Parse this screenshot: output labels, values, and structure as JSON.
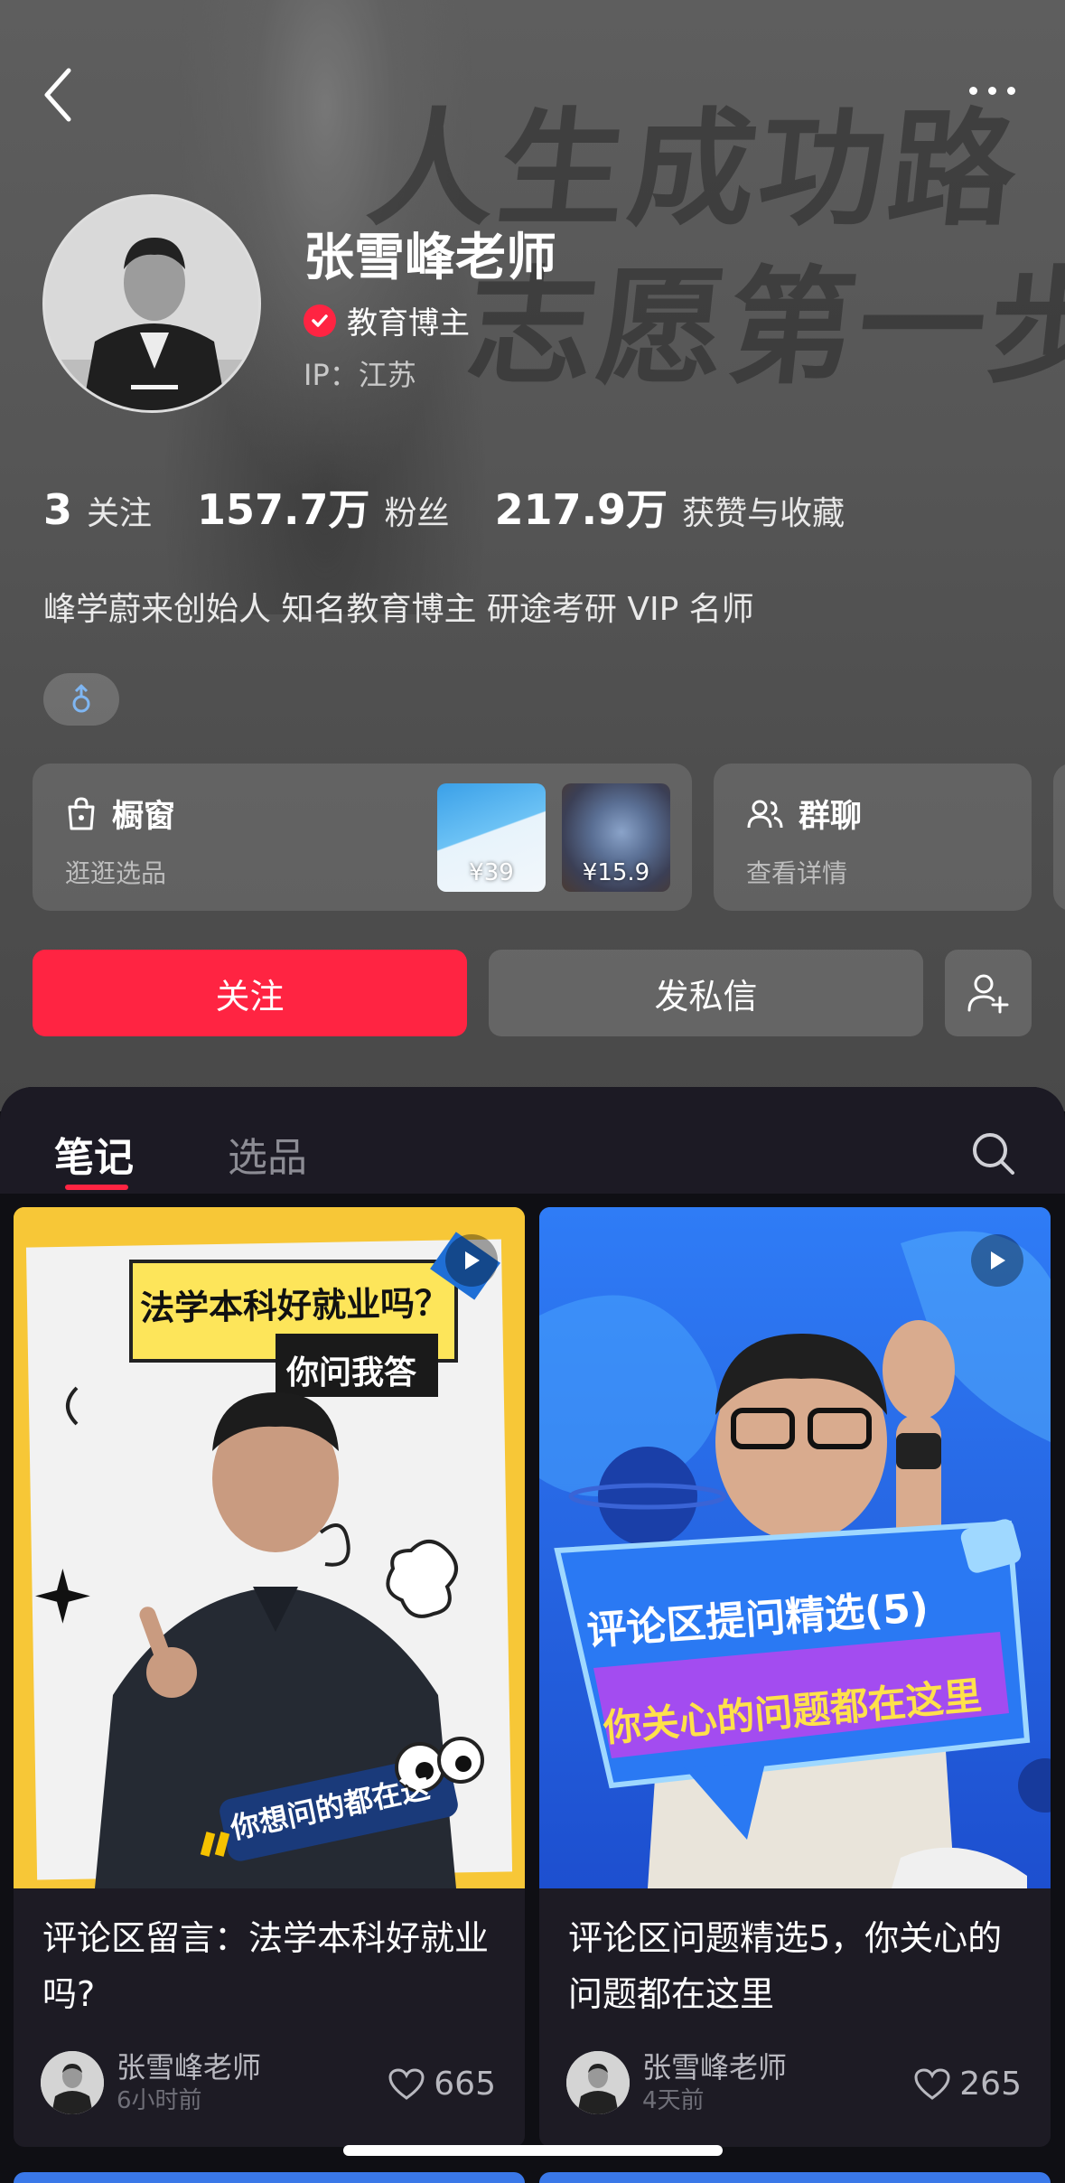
{
  "profile": {
    "name": "张雪峰老师",
    "verify_label": "教育博主",
    "ip_label": "IP：",
    "ip_region": "江苏",
    "background_slogan_line1": "人生成功路",
    "background_slogan_line2": "志愿第一步",
    "bio": "峰学蔚来创始人 知名教育博主 研途考研 VIP 名师",
    "gender_icon": "male-icon"
  },
  "stats": [
    {
      "value": "3",
      "label": "关注"
    },
    {
      "value": "157.7万",
      "label": "粉丝"
    },
    {
      "value": "217.9万",
      "label": "获赞与收藏"
    }
  ],
  "cards": {
    "shop": {
      "title": "橱窗",
      "subtitle": "逛逛选品",
      "price1": "¥39",
      "price2": "¥15.9"
    },
    "group": {
      "title": "群聊",
      "subtitle": "查看详情"
    }
  },
  "actions": {
    "follow": "关注",
    "message": "发私信"
  },
  "tabs": [
    {
      "label": "笔记",
      "active": true
    },
    {
      "label": "选品",
      "active": false
    }
  ],
  "notes": [
    {
      "title": "评论区留言：法学本科好就业吗?",
      "cover_text1": "法学本科好就业吗？",
      "cover_text2": "你问我答",
      "cover_text3": "你想问的都在这",
      "author": "张雪峰老师",
      "time": "6小时前",
      "likes": "665"
    },
    {
      "title": "评论区问题精选5，你关心的问题都在这里",
      "cover_text1": "评论区提问精选(5)",
      "cover_text2": "你关心的问题都在这里",
      "author": "张雪峰老师",
      "time": "4天前",
      "likes": "265"
    }
  ],
  "colors": {
    "accent": "#ff2442",
    "panel": "#0f0f14",
    "header": "#565656"
  }
}
